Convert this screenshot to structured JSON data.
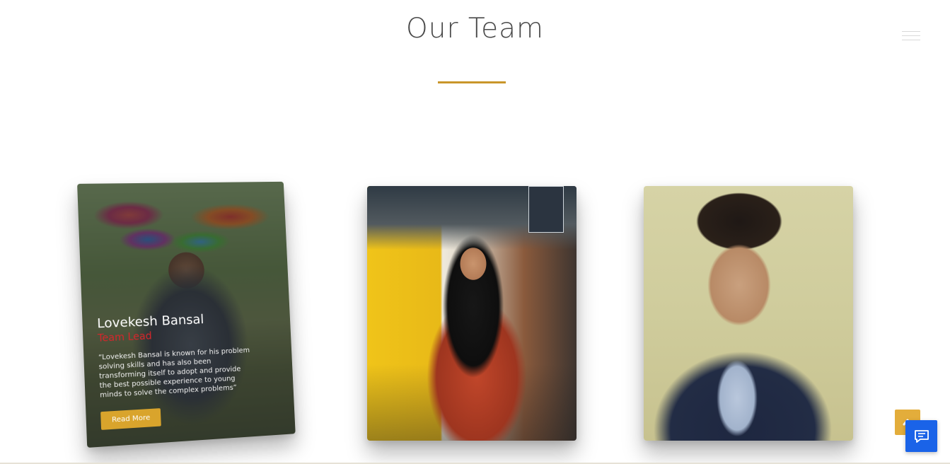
{
  "section": {
    "title": "Our Team"
  },
  "colors": {
    "accent_gold": "#c9962a",
    "button_gold": "#d9a42c",
    "role_red": "#d7262b",
    "chat_blue": "#1a63e8"
  },
  "icons": {
    "menu": "hamburger-menu-icon",
    "scroll_top": "chevron-up-icon",
    "chat": "chat-bubble-icon"
  },
  "team": [
    {
      "name": "Lovekesh Bansal",
      "role": "Team Lead",
      "quote": "“Lovekesh Bansal is known for his problem solving skills and has also been transforming itself to adopt and provide the best possible experience to young minds to solve the complex problems”",
      "button_label": "Read More"
    },
    {
      "name": "",
      "role": ""
    },
    {
      "name": "",
      "role": ""
    }
  ]
}
